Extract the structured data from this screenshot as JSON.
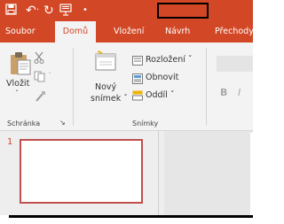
{
  "quick_access": {
    "save_icon": "save-icon",
    "undo_glyph": "↶",
    "dropdown_glyph": "·",
    "redo_glyph": "↻",
    "present_icon": "present-icon",
    "customize_glyph": "•"
  },
  "tabs": [
    {
      "label": "Soubor"
    },
    {
      "label": "Domů",
      "active": true
    },
    {
      "label": "Vložení"
    },
    {
      "label": "Návrh",
      "highlighted": true
    },
    {
      "label": "Přechody"
    }
  ],
  "ribbon": {
    "clipboard": {
      "paste_label": "Vložit",
      "group_label": "Schránka",
      "launcher_glyph": "↘"
    },
    "slides": {
      "new_slide_line1": "Nový",
      "new_slide_line2": "snímek ˇ",
      "layout_label": "Rozložení ˇ",
      "reset_label": "Obnovit",
      "section_label": "Oddíl ˇ",
      "group_label": "Snímky"
    },
    "font": {
      "bold_label": "B",
      "italic_label": "I"
    }
  },
  "thumbnails": [
    {
      "number": "1"
    }
  ],
  "colors": {
    "accent": "#d24726",
    "ribbon_bg": "#f3f3f3"
  }
}
